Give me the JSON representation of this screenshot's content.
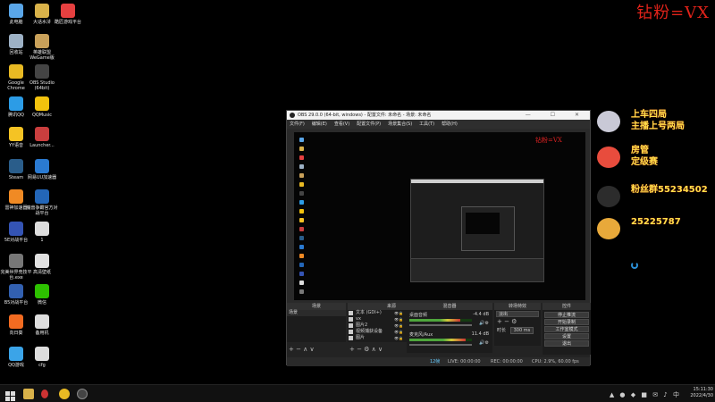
{
  "desktop": {
    "icons": [
      {
        "label": "此电脑",
        "color": "#5aa6e8"
      },
      {
        "label": "大话水浒",
        "color": "#d9b24a"
      },
      {
        "label": "酷匠游戏平台",
        "color": "#e64040"
      },
      {
        "label": "回收站",
        "color": "#9db1c5"
      },
      {
        "label": "英雄联盟 WeGame版",
        "color": "#c9a15a"
      },
      {
        "label": "Google Chrome",
        "color": "#e8b923"
      },
      {
        "label": "OBS Studio (64bit)",
        "color": "#444444"
      },
      {
        "label": "腾讯QQ",
        "color": "#2c9ce6"
      },
      {
        "label": "QQMusic",
        "color": "#f2c20d"
      },
      {
        "label": "YY语音",
        "color": "#f5c324"
      },
      {
        "label": "Launcher...",
        "color": "#c93e3e"
      },
      {
        "label": "Steam",
        "color": "#2a5d8a"
      },
      {
        "label": "网易UU加速器",
        "color": "#2a7ad1"
      },
      {
        "label": "雷神加速器",
        "color": "#f08a24"
      },
      {
        "label": "魔兽争霸官方对战平台",
        "color": "#2366b8"
      },
      {
        "label": "5E对战平台",
        "color": "#3454b4"
      },
      {
        "label": "1",
        "color": "#dddddd"
      },
      {
        "label": "完美世界竞技平台.exe",
        "color": "#777777"
      },
      {
        "label": "高清壁纸",
        "color": "#e0e0e0"
      },
      {
        "label": "B5对战平台",
        "color": "#3260b0"
      },
      {
        "label": "微信",
        "color": "#2dc100"
      },
      {
        "label": "向日葵",
        "color": "#f26b21"
      },
      {
        "label": "备用机",
        "color": "#dddddd"
      },
      {
        "label": "QQ游戏",
        "color": "#3ba4e8"
      },
      {
        "label": "cfg",
        "color": "#dddddd"
      }
    ]
  },
  "overlay": {
    "top_text": "钻粉=VX",
    "items": [
      {
        "line1": "上车四局",
        "line2": "主播上号两局",
        "pic_color": "#c9c9d6"
      },
      {
        "line1": "房管",
        "line2": "定级赛",
        "pic_color": "#e84c3d"
      },
      {
        "line1": "粉丝群55234502",
        "line2": "",
        "pic_color": "#2c2c2c"
      },
      {
        "line1": "25225787",
        "line2": "",
        "pic_color": "#e8a93a"
      }
    ]
  },
  "obs": {
    "title": "OBS 29.0.0 (64-bit, windows) - 配置文件: 未命名 - 场景: 未命名",
    "menu": [
      "文件(F)",
      "编辑(E)",
      "查看(V)",
      "配置文件(P)",
      "场景集合(S)",
      "工具(T)",
      "帮助(H)"
    ],
    "preview_mini_text": "钻粉=VX",
    "docks": {
      "scenes": {
        "header": "场景",
        "items": [
          "场景"
        ]
      },
      "sources": {
        "header": "来源",
        "items": [
          "文本 (GDI+)",
          "vx",
          "图片2",
          "视频捕获设备",
          "图片"
        ]
      },
      "mixer": {
        "header": "混音器",
        "tracks": [
          {
            "name": "桌面音频",
            "db": "-4.4 dB",
            "level": 0.82
          },
          {
            "name": "麦克风/Aux",
            "db": "11.4 dB",
            "level": 0.9
          }
        ]
      },
      "transitions": {
        "header": "转场特效",
        "type": "淡出",
        "duration_label": "时长",
        "duration": "300 ms"
      },
      "controls": {
        "header": "控件",
        "buttons": [
          "停止推流",
          "开始录制",
          "工作室模式",
          "设置",
          "退出"
        ]
      }
    },
    "status": {
      "live": "LIVE: 00:00:00",
      "rec": "REC: 00:00:00",
      "cpu": "CPU: 2.9%, 60.00 fps",
      "frames": "12帧"
    }
  },
  "taskbar": {
    "time": "15:11:30",
    "date": "2022/4/30"
  }
}
